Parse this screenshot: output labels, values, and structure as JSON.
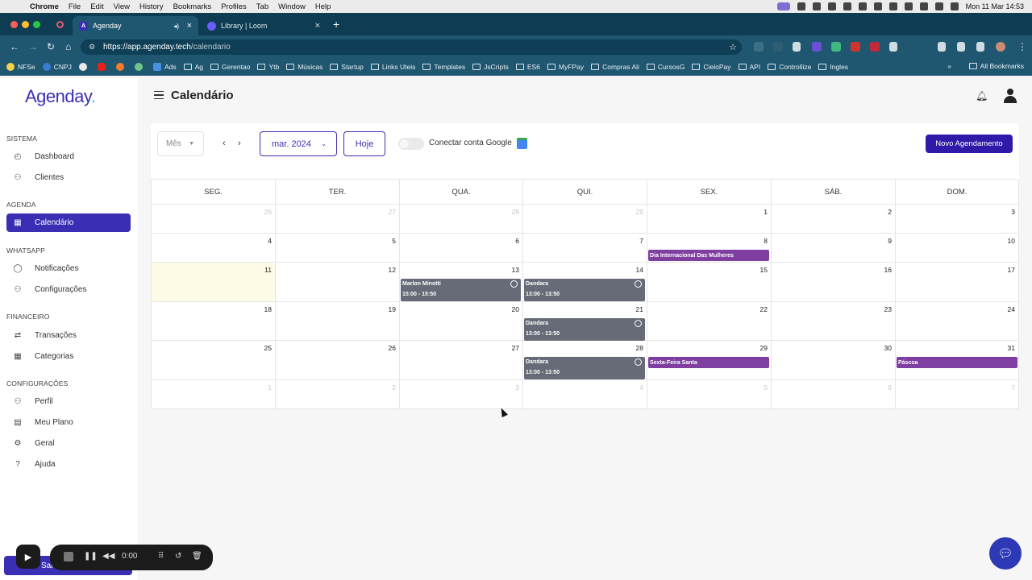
{
  "menubar": {
    "app": "Chrome",
    "items": [
      "File",
      "Edit",
      "View",
      "History",
      "Bookmarks",
      "Profiles",
      "Tab",
      "Window",
      "Help"
    ],
    "clock": "Mon 11 Mar  14:53"
  },
  "tabs": [
    {
      "title": "Agenday",
      "active": true
    },
    {
      "title": "Library | Loom",
      "active": false
    }
  ],
  "address": {
    "host": "https://app.agenday.tech",
    "path": "/calendario"
  },
  "bookmarks": [
    "NFSe",
    "CNPJ",
    "Ads",
    "Ag",
    "Gerentao",
    "Ytb",
    "Músicas",
    "Startup",
    "Links Uteis",
    "Templates",
    "JsCripts",
    "ES6",
    "MyFPay",
    "Compras Ali",
    "CursosG",
    "CieloPay",
    "API",
    "Controllize",
    "Ingles"
  ],
  "bookmarks_all": "All Bookmarks",
  "brand": {
    "logo": "Agenday",
    "logo_dot": "."
  },
  "sidebar": {
    "sections": [
      {
        "title": "SISTEMA",
        "items": [
          {
            "label": "Dashboard",
            "icon": "gauge-icon"
          },
          {
            "label": "Clientes",
            "icon": "users-icon"
          }
        ]
      },
      {
        "title": "AGENDA",
        "items": [
          {
            "label": "Calendário",
            "icon": "calendar-icon",
            "active": true
          }
        ]
      },
      {
        "title": "WHATSAPP",
        "items": [
          {
            "label": "Notificações",
            "icon": "chat-icon"
          },
          {
            "label": "Configurações",
            "icon": "user-gear-icon"
          }
        ]
      },
      {
        "title": "FINANCEIRO",
        "items": [
          {
            "label": "Transações",
            "icon": "exchange-icon"
          },
          {
            "label": "Categorias",
            "icon": "grid-icon"
          }
        ]
      },
      {
        "title": "CONFIGURAÇÕES",
        "items": [
          {
            "label": "Perfil",
            "icon": "user-icon"
          },
          {
            "label": "Meu Plano",
            "icon": "receipt-icon"
          },
          {
            "label": "Geral",
            "icon": "gear-icon"
          },
          {
            "label": "Ajuda",
            "icon": "help-icon"
          }
        ]
      }
    ],
    "bottom_button": "Sai"
  },
  "page": {
    "title": "Calendário"
  },
  "calendar": {
    "view_select": "Mês",
    "month": "mar. 2024",
    "today_button": "Hoje",
    "google_label": "Conectar conta Google",
    "new_button": "Novo Agendamento",
    "weekdays": [
      "SEG.",
      "TER.",
      "QUA.",
      "QUI.",
      "SEX.",
      "SÁB.",
      "DOM."
    ],
    "weeks": [
      [
        "26",
        "27",
        "28",
        "29",
        "1",
        "2",
        "3"
      ],
      [
        "4",
        "5",
        "6",
        "7",
        "8",
        "9",
        "10"
      ],
      [
        "11",
        "12",
        "13",
        "14",
        "15",
        "16",
        "17"
      ],
      [
        "18",
        "19",
        "20",
        "21",
        "22",
        "23",
        "24"
      ],
      [
        "25",
        "26",
        "27",
        "28",
        "29",
        "30",
        "31"
      ],
      [
        "1",
        "2",
        "3",
        "4",
        "5",
        "6",
        "7"
      ]
    ],
    "events": [
      {
        "type": "holiday",
        "title": "Dia Internacional Das Mulheres",
        "week": 1,
        "day": 4
      },
      {
        "type": "appt",
        "title": "Marlon Minotti",
        "time": "15:00 - 15:50",
        "week": 2,
        "day": 2
      },
      {
        "type": "appt",
        "title": "Dandara",
        "time": "13:00 - 13:50",
        "week": 2,
        "day": 3
      },
      {
        "type": "appt",
        "title": "Dandara",
        "time": "13:00 - 13:50",
        "week": 3,
        "day": 3
      },
      {
        "type": "appt",
        "title": "Dandara",
        "time": "13:00 - 13:50",
        "week": 4,
        "day": 3
      },
      {
        "type": "holiday",
        "title": "Sexta-Feira Santa",
        "week": 4,
        "day": 4
      },
      {
        "type": "holiday",
        "title": "Páscoa",
        "week": 4,
        "day": 6
      }
    ]
  },
  "loom": {
    "timer": "0:00"
  }
}
